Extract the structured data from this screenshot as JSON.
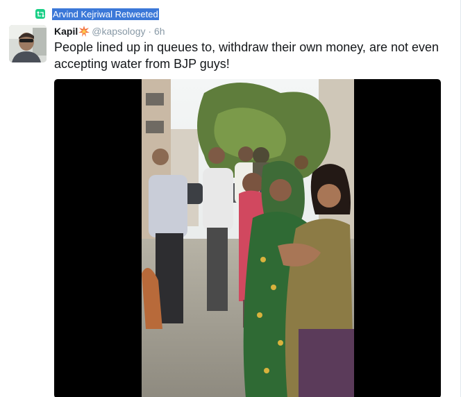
{
  "retweet": {
    "label": "Arvind Kejriwal Retweeted",
    "icon": "retweet-icon",
    "icon_color": "#19cf86",
    "highlight_color": "#3b78d8"
  },
  "author": {
    "name": "Kapil",
    "badge_icon": "explosion-emoji-icon",
    "handle": "@kapsology",
    "separator": "·",
    "time": "6h"
  },
  "tweet": {
    "text": "People lined up in queues to, withdraw their own money, are not even accepting water from BJP guys!"
  },
  "media": {
    "type": "video",
    "background": "#000000"
  }
}
